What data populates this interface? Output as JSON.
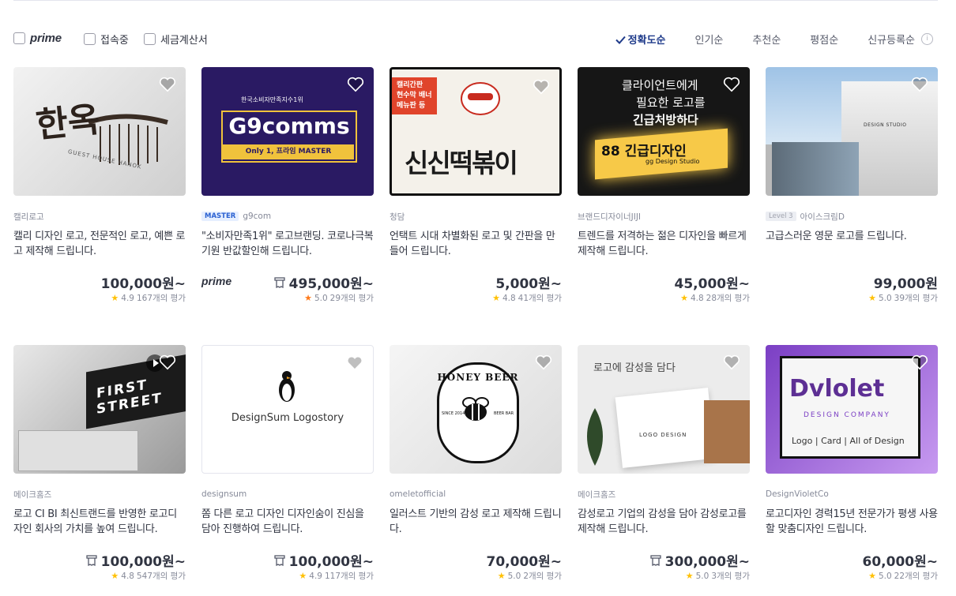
{
  "filters": {
    "prime_label": "prime",
    "online_label": "접속중",
    "tax_label": "세금계산서"
  },
  "sorts": {
    "accuracy": "정확도순",
    "popular": "인기순",
    "recommend": "추천순",
    "rating": "평점순",
    "newest": "신규등록순",
    "info_icon": "i"
  },
  "gigs": [
    {
      "seller": "캘리로고",
      "title": "캘리 디자인 로고, 전문적인 로고, 예쁜 로고 제작해 드립니다.",
      "price": "100,000원~",
      "score": "4.9",
      "reviews": "167개의 평가",
      "thumb": {
        "text": "한옥",
        "sub": "GUEST HOUSE HANOK"
      }
    },
    {
      "seller": "g9com",
      "badge": "MASTER",
      "prime": "prime",
      "title": "\"소비자만족1위\" 로고브랜딩. 코로나극복기원 반값할인해 드립니다.",
      "price": "495,000원~",
      "score": "5.0",
      "reviews": "29개의 평가",
      "thumb": {
        "top": "한국소비자만족지수1위",
        "text": "G9comms",
        "sub": "Only 1, 프라임 MASTER"
      }
    },
    {
      "seller": "청담",
      "title": "언택트 시대 차별화된 로고 및 간판을 만들어 드립니다.",
      "price": "5,000원~",
      "score": "4.8",
      "reviews": "41개의 평가",
      "thumb": {
        "tag": "캘리간판\n현수막 배너\n메뉴판 등",
        "text": "신신떡볶이"
      }
    },
    {
      "seller": "브랜드디자이너JIJI",
      "title": "트렌드를 저격하는 젊은 디자인을 빠르게 제작해 드립니다.",
      "price": "45,000원~",
      "score": "4.8",
      "reviews": "28개의 평가",
      "thumb": {
        "line1": "클라이언트에게",
        "line2": "필요한 로고를",
        "line3": "긴급처방하다",
        "text": "88 긴급디자인",
        "sub": "gg Design Studio"
      }
    },
    {
      "seller": "아이스크림D",
      "level": "Level 3",
      "title": "고급스러운 영문 로고를 드립니다.",
      "price": "99,000원",
      "score": "5.0",
      "reviews": "39개의 평가",
      "thumb": {
        "text": "DESIGN STUDIO"
      }
    },
    {
      "seller": "메이크홈즈",
      "title": "로고 CI BI 최신트랜드를 반영한 로고디자인 회사의 가치를 높여 드립니다.",
      "price": "100,000원~",
      "score": "4.8",
      "reviews": "547개의 평가",
      "thumb": {
        "text": "FIRST STREET"
      }
    },
    {
      "seller": "designsum",
      "title": "쫌 다른 로고 디자인 디자인숨이 진심을 담아 진행하여 드립니다.",
      "price": "100,000원~",
      "score": "4.9",
      "reviews": "117개의 평가",
      "thumb": {
        "text": "DesignSum Logostory"
      }
    },
    {
      "seller": "omeletofficial",
      "title": "일러스트 기반의 감성 로고 제작해 드립니다.",
      "price": "70,000원~",
      "score": "5.0",
      "reviews": "2개의 평가",
      "thumb": {
        "text": "HONEY BEER",
        "since": "SINCE 2014",
        "bar": "BEER BAR"
      }
    },
    {
      "seller": "메이크홈즈",
      "title": "감성로고 기업의 감성을 담아 감성로고를 제작해 드립니다.",
      "price": "300,000원~",
      "score": "5.0",
      "reviews": "3개의 평가",
      "thumb": {
        "text": "로고에 감성을 담다",
        "sub": "LOGO DESIGN"
      }
    },
    {
      "seller": "DesignVioletCo",
      "title": "로고디자인 경력15년 전문가가 평생 사용할 맞춤디자인 드립니다.",
      "price": "60,000원~",
      "score": "5.0",
      "reviews": "22개의 평가",
      "thumb": {
        "text": "Dvlolet",
        "sub": "DESIGN COMPANY",
        "line1": "Logo | Card | All of Design"
      }
    }
  ],
  "colors": {
    "accent": "#1e3a8a",
    "star": "#ffc107",
    "star_orange": "#ff7a1a"
  }
}
